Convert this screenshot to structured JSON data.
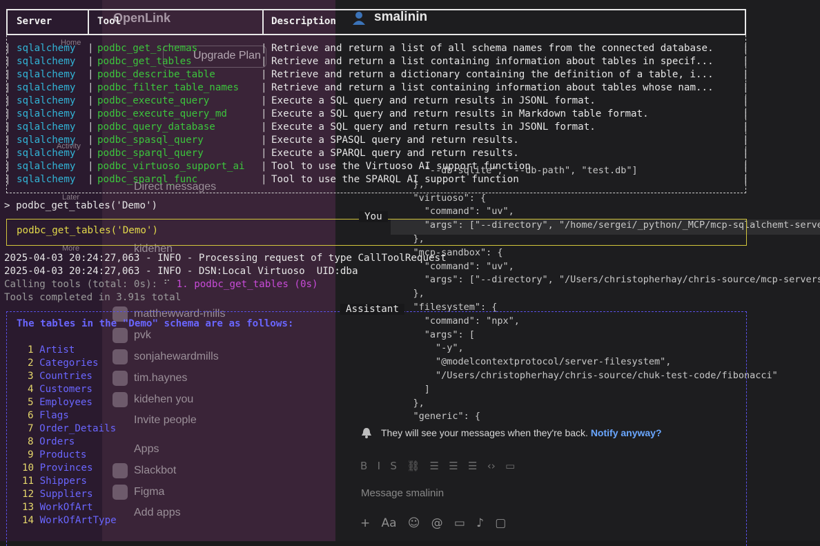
{
  "background_app": {
    "workspace": "OpenLink",
    "upgrade_button": "Upgrade Plan",
    "rail_items": [
      "Home",
      "Activity",
      "Later",
      "More"
    ],
    "sidebar_section_dms": "Direct messages",
    "sidebar_dms": [
      "kidehen",
      "matthewward-mills",
      "pvk",
      "sonjahewardmills",
      "tim.haynes",
      "kidehen  you"
    ],
    "invite": "Invite people",
    "apps_section": "Apps",
    "apps": [
      "Slackbot",
      "Figma"
    ],
    "add_apps": "Add apps",
    "channel_title": "smalinin",
    "notice_text": "They will see your messages when they're back.",
    "notice_link": "Notify anyway?",
    "message_placeholder": "Message smalinin",
    "code_lines": [
      "      \"--db-sqlite\", \"--db-path\", \"test.db\"]",
      "    },",
      "    \"virtuoso\": {",
      "      \"command\": \"uv\",",
      "      \"args\": [\"--directory\", \"/home/sergei/_python/_MCP/mcp-sqlalchemt-serve",
      "    },",
      "    \"mcp-sandbox\": {",
      "      \"command\": \"uv\",",
      "      \"args\": [\"--directory\", \"/Users/christopherhay/chris-source/mcp-servers",
      "    },",
      "    \"filesystem\": {",
      "      \"command\": \"npx\",",
      "      \"args\": [",
      "        \"-y\",",
      "        \"@modelcontextprotocol/server-filesystem\",",
      "        \"/Users/christopherhay/chris-source/chuk-test-code/fibonacci\"",
      "      ]",
      "    },",
      "    \"generic\": {"
    ]
  },
  "tools_table": {
    "headers": {
      "server": "Server",
      "tool": "Tool",
      "description": "Description"
    },
    "rows": [
      {
        "server": "sqlalchemy",
        "tool": "podbc_get_schemas",
        "description": "Retrieve and return a list of all schema names from the connected database."
      },
      {
        "server": "sqlalchemy",
        "tool": "podbc_get_tables",
        "description": "Retrieve and return a list containing information about tables in specif..."
      },
      {
        "server": "sqlalchemy",
        "tool": "podbc_describe_table",
        "description": "Retrieve and return a dictionary containing the definition of a table, i..."
      },
      {
        "server": "sqlalchemy",
        "tool": "podbc_filter_table_names",
        "description": "Retrieve and return a list containing information about tables whose nam..."
      },
      {
        "server": "sqlalchemy",
        "tool": "podbc_execute_query",
        "description": "Execute a SQL query and return results in JSONL format."
      },
      {
        "server": "sqlalchemy",
        "tool": "podbc_execute_query_md",
        "description": "Execute a SQL query and return results in Markdown table format."
      },
      {
        "server": "sqlalchemy",
        "tool": "podbc_query_database",
        "description": "Execute a SQL query and return results in JSONL format."
      },
      {
        "server": "sqlalchemy",
        "tool": "podbc_spasql_query",
        "description": "Execute a SPASQL query and return results."
      },
      {
        "server": "sqlalchemy",
        "tool": "podbc_sparql_query",
        "description": "Execute a SPARQL query and return results."
      },
      {
        "server": "sqlalchemy",
        "tool": "podbc_virtuoso_support_ai",
        "description": "Tool to use the Virtuoso AI support function"
      },
      {
        "server": "sqlalchemy",
        "tool": "podbc_sparql_func",
        "description": "Tool to use the SPARQL AI support function"
      }
    ]
  },
  "prompt": {
    "marker": ">",
    "command": "podbc_get_tables('Demo')"
  },
  "you_panel": {
    "label": "You",
    "text": "podbc_get_tables('Demo')"
  },
  "logs": [
    "2025-04-03 20:24:27,063 - INFO - Processing request of type CallToolRequest",
    "2025-04-03 20:24:27,063 - INFO - DSN:Local Virtuoso  UID:dba"
  ],
  "calling": {
    "prefix": "Calling tools (total: 0s):",
    "spinner": "⠋",
    "item": "1. podbc_get_tables (0s)"
  },
  "completed": "Tools completed in 3.91s total",
  "assistant_panel": {
    "label": "Assistant",
    "intro": "The tables in the \"Demo\" schema are as follows:",
    "tables": [
      {
        "n": "1",
        "name": "Artist"
      },
      {
        "n": "2",
        "name": "Categories"
      },
      {
        "n": "3",
        "name": "Countries"
      },
      {
        "n": "4",
        "name": "Customers"
      },
      {
        "n": "5",
        "name": "Employees"
      },
      {
        "n": "6",
        "name": "Flags"
      },
      {
        "n": "7",
        "name": "Order_Details"
      },
      {
        "n": "8",
        "name": "Orders"
      },
      {
        "n": "9",
        "name": "Products"
      },
      {
        "n": "10",
        "name": "Provinces"
      },
      {
        "n": "11",
        "name": "Shippers"
      },
      {
        "n": "12",
        "name": "Suppliers"
      },
      {
        "n": "13",
        "name": "WorkOfArt"
      },
      {
        "n": "14",
        "name": "WorkOfArtType"
      }
    ]
  },
  "colors": {
    "server": "#32b4d6",
    "tool": "#3cc43c",
    "you_border": "#d4c73c",
    "assistant": "#6a66ff",
    "tool_call": "#c84bd8"
  }
}
